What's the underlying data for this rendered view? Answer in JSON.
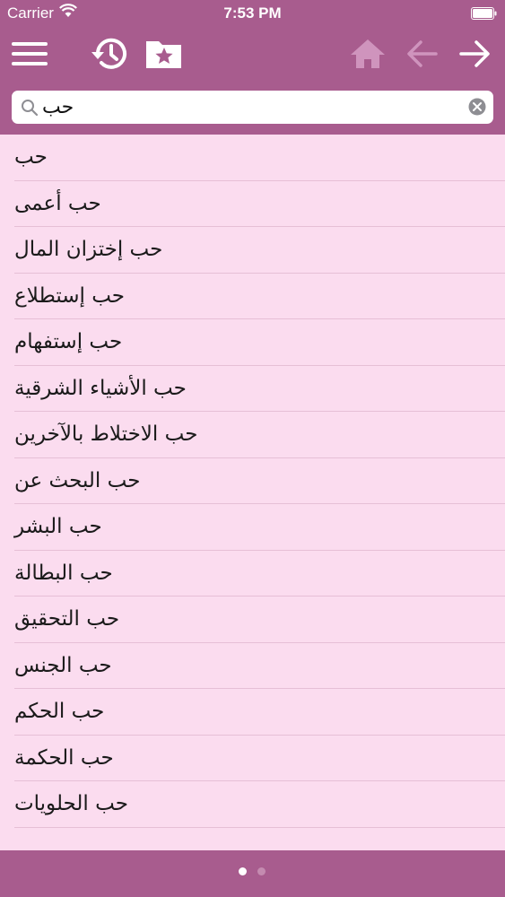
{
  "status_bar": {
    "carrier": "Carrier",
    "time": "7:53 PM"
  },
  "toolbar": {
    "icons": [
      "menu-icon",
      "history-icon",
      "favorites-folder-icon",
      "home-icon",
      "back-arrow-icon",
      "forward-arrow-icon"
    ],
    "back_enabled": false,
    "home_enabled": false,
    "forward_enabled": true
  },
  "search": {
    "value": "حب",
    "placeholder": ""
  },
  "results": [
    "حب",
    "حب أعمى",
    "حب إختزان المال",
    "حب إستطلاع",
    "حب إستفهام",
    "حب الأشياء الشرقية",
    "حب الاختلاط بالآخرين",
    "حب البحث عن",
    "حب البشر",
    "حب البطالة",
    "حب التحقيق",
    "حب الجنس",
    "حب الحكم",
    "حب الحكمة",
    "حب الحلويات"
  ],
  "pagination": {
    "pages": 2,
    "current": 1
  },
  "colors": {
    "bar": "#a85c8e",
    "list_background": "#fbdcef",
    "separator": "#e6bfd6",
    "disabled_icon": "#cf94bd"
  }
}
